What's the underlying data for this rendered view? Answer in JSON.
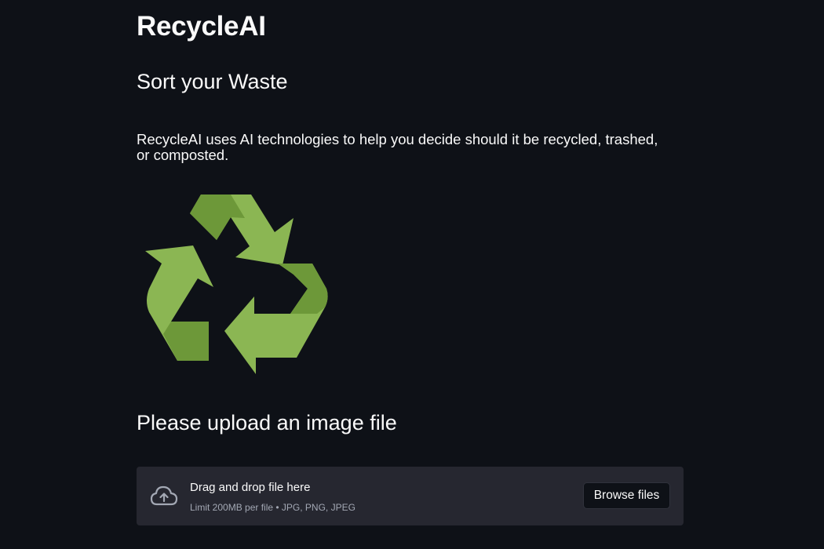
{
  "app": {
    "title": "RecycleAI"
  },
  "intro": {
    "subtitle": "Sort your Waste",
    "description": "RecycleAI uses AI technologies to help you decide should it be recycled, trashed, or composted."
  },
  "logo": {
    "icon": "recycle-icon",
    "colors": {
      "light": "#8bb653",
      "dark": "#6d9839"
    }
  },
  "upload": {
    "heading": "Please upload an image file",
    "dropzone": {
      "icon": "cloud-upload-icon",
      "title": "Drag and drop file here",
      "hint": "Limit 200MB per file • JPG, PNG, JPEG",
      "browse_label": "Browse files"
    }
  },
  "theme": {
    "background": "#0e1117",
    "text": "#fafafa",
    "dropzone_background": "#262730"
  }
}
